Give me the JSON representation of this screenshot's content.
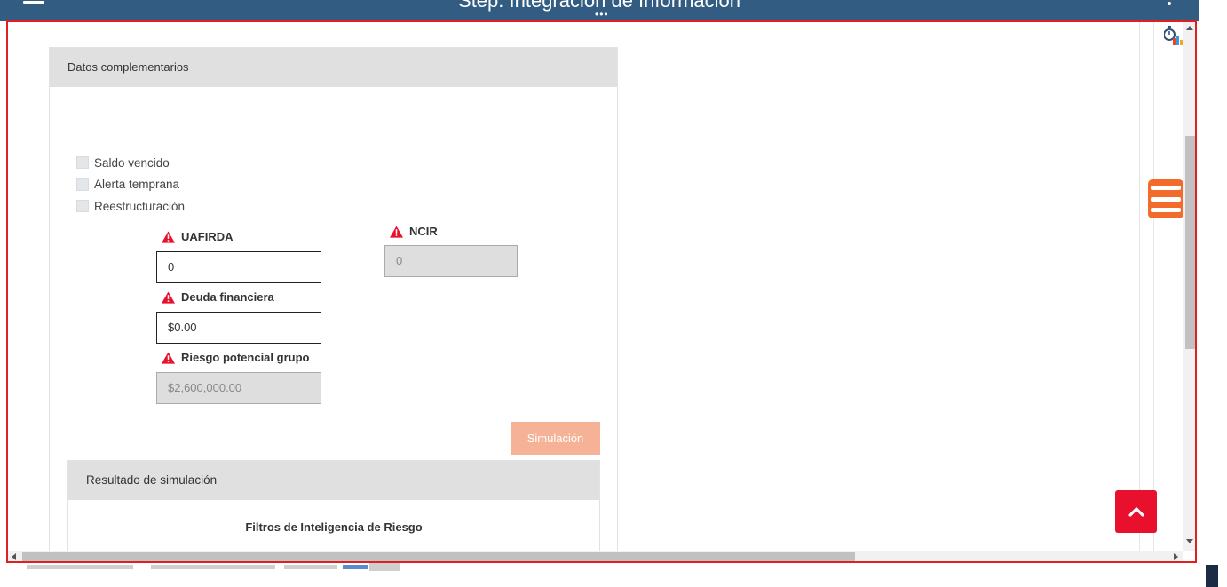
{
  "window": {
    "title": "Step: Integración de Información",
    "more_dots": "•••"
  },
  "panel": {
    "header": "Datos complementarios",
    "checkboxes": [
      {
        "label": "Saldo vencido",
        "checked": false
      },
      {
        "label": "Alerta temprana",
        "checked": false
      },
      {
        "label": "Reestructuración",
        "checked": false
      }
    ],
    "fields": {
      "uafirda": {
        "label": "UAFIRDA",
        "value": "0"
      },
      "ncir": {
        "label": "NCIR",
        "value": "0"
      },
      "deuda": {
        "label": "Deuda financiera",
        "value": "$0.00"
      },
      "riesgo": {
        "label": "Riesgo potencial grupo",
        "value": "$2,600,000.00"
      }
    },
    "simulate_label": "Simulación",
    "result": {
      "header": "Resultado de simulación",
      "subtitle": "Filtros de Inteligencia de Riesgo"
    }
  },
  "colors": {
    "topbar": "#325c82",
    "frame_border": "#e02020",
    "warning": "#e8102d",
    "simulate_button": "#f5b296",
    "menu_button": "#f26b2b",
    "scroll_top_button": "#e8102d"
  },
  "icons": {
    "warning": "warning-triangle-icon",
    "menu": "hamburger-menu-icon",
    "timer": "stopwatch-chart-icon",
    "scroll_top": "chevron-up-icon"
  }
}
